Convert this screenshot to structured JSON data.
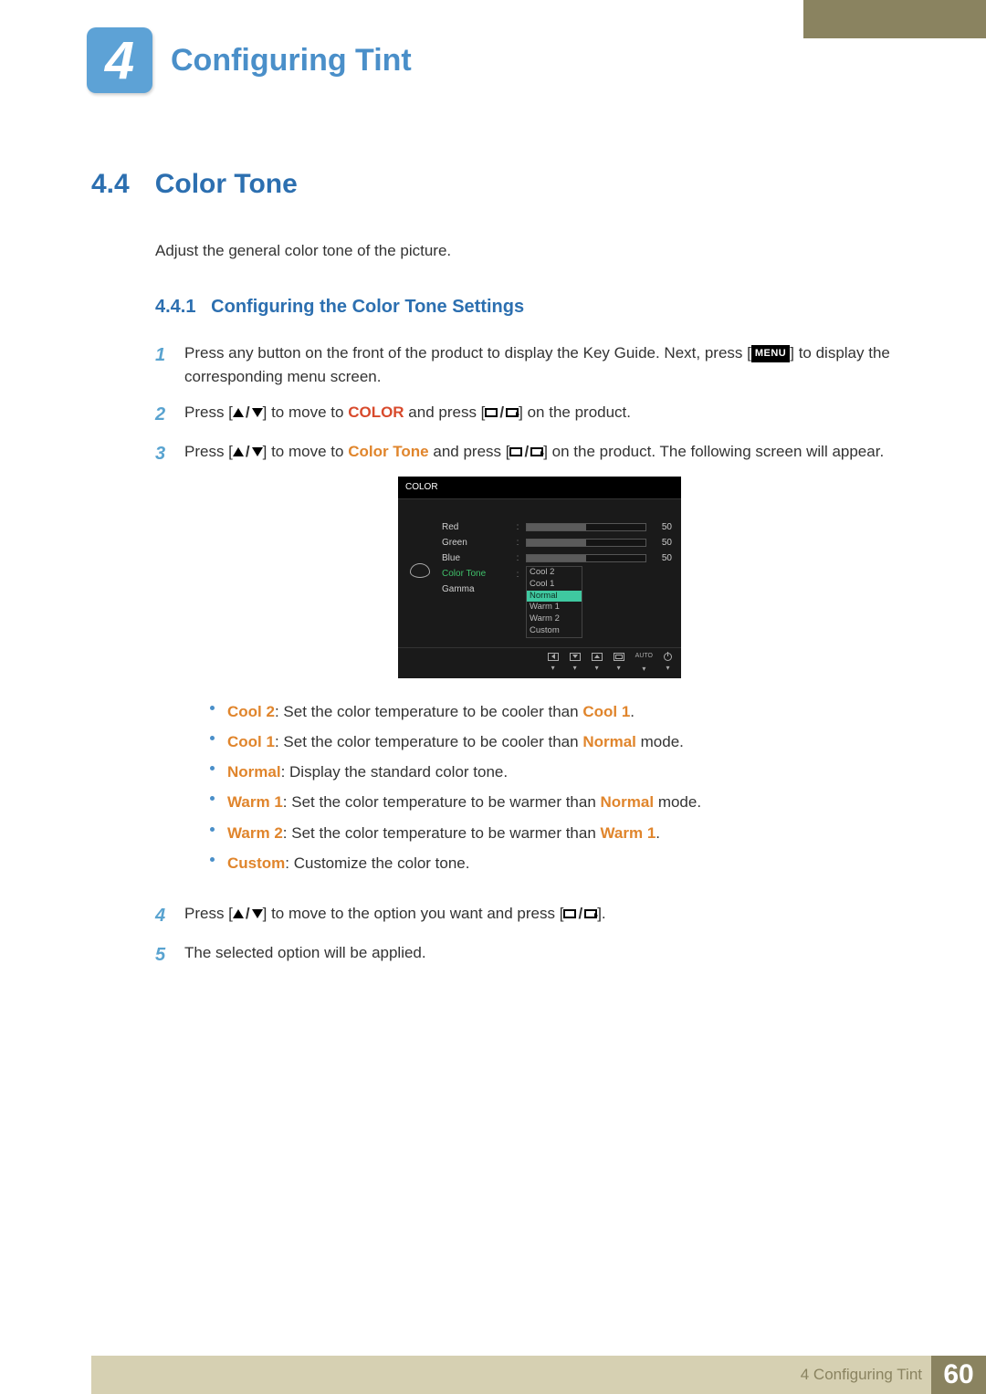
{
  "chapter": {
    "number": "4",
    "title": "Configuring Tint"
  },
  "section": {
    "number": "4.4",
    "title": "Color Tone"
  },
  "intro": "Adjust the general color tone of the picture.",
  "subsection": {
    "number": "4.4.1",
    "title": "Configuring the Color Tone Settings"
  },
  "steps": {
    "s1a": "Press any button on the front of the product to display the Key Guide. Next, press [",
    "s1b": "] to display the corresponding menu screen.",
    "menu_label": "MENU",
    "s2a": "Press [",
    "s2b": "] to move to ",
    "s2c": " and press [",
    "s2d": "] on the product.",
    "color_word": "COLOR",
    "s3a": "Press [",
    "s3b": "] to move to ",
    "s3c": " and press [",
    "s3d": "] on the product. The following screen will appear.",
    "colortone_word": "Color Tone",
    "s4a": "Press [",
    "s4b": "] to move to the option you want and press [",
    "s4c": "].",
    "s5": "The selected option will be applied."
  },
  "osd": {
    "title": "COLOR",
    "rows": {
      "red": {
        "label": "Red",
        "value": "50"
      },
      "green": {
        "label": "Green",
        "value": "50"
      },
      "blue": {
        "label": "Blue",
        "value": "50"
      },
      "colortone": {
        "label": "Color Tone"
      },
      "gamma": {
        "label": "Gamma"
      }
    },
    "dropdown": {
      "i0": "Cool 2",
      "i1": "Cool 1",
      "i2": "Normal",
      "i3": "Warm 1",
      "i4": "Warm 2",
      "i5": "Custom"
    },
    "footer_auto": "AUTO"
  },
  "bullets": {
    "cool2_k": "Cool 2",
    "cool2_v": ": Set the color temperature to be cooler than ",
    "cool2_r": "Cool 1",
    "cool2_e": ".",
    "cool1_k": "Cool 1",
    "cool1_v": ": Set the color temperature to be cooler than ",
    "cool1_r": "Normal",
    "cool1_e": " mode.",
    "normal_k": "Normal",
    "normal_v": ": Display the standard color tone.",
    "warm1_k": "Warm 1",
    "warm1_v": ": Set the color temperature to be warmer than ",
    "warm1_r": "Normal",
    "warm1_e": " mode.",
    "warm2_k": "Warm 2",
    "warm2_v": ": Set the color temperature to be warmer than ",
    "warm2_r": "Warm 1",
    "warm2_e": ".",
    "custom_k": "Custom",
    "custom_v": ": Customize the color tone."
  },
  "footer": {
    "text": "4 Configuring Tint",
    "page": "60"
  }
}
